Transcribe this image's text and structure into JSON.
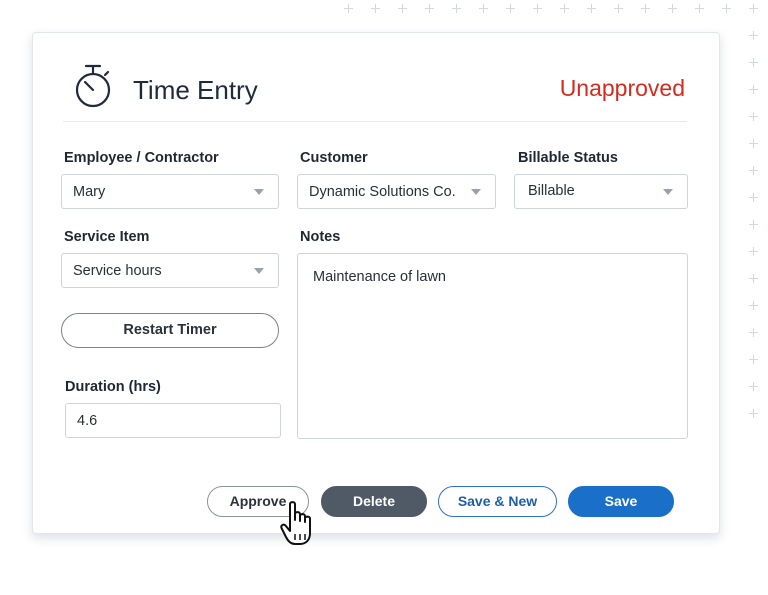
{
  "header": {
    "title": "Time Entry",
    "status": "Unapproved",
    "icon": "stopwatch-icon"
  },
  "fields": {
    "employee": {
      "label": "Employee / Contractor",
      "value": "Mary"
    },
    "customer": {
      "label": "Customer",
      "value": "Dynamic Solutions Co."
    },
    "billable": {
      "label": "Billable Status",
      "value": "Billable"
    },
    "service_item": {
      "label": "Service Item",
      "value": "Service hours"
    },
    "notes": {
      "label": "Notes",
      "value": "Maintenance of lawn"
    },
    "duration": {
      "label": "Duration (hrs)",
      "value": "4.6"
    }
  },
  "buttons": {
    "restart_timer": "Restart Timer",
    "approve": "Approve",
    "delete": "Delete",
    "save_new": "Save & New",
    "save": "Save"
  },
  "colors": {
    "status_red": "#d52b1e",
    "primary_blue": "#1a6fc9",
    "delete_gray": "#4f5a66"
  }
}
